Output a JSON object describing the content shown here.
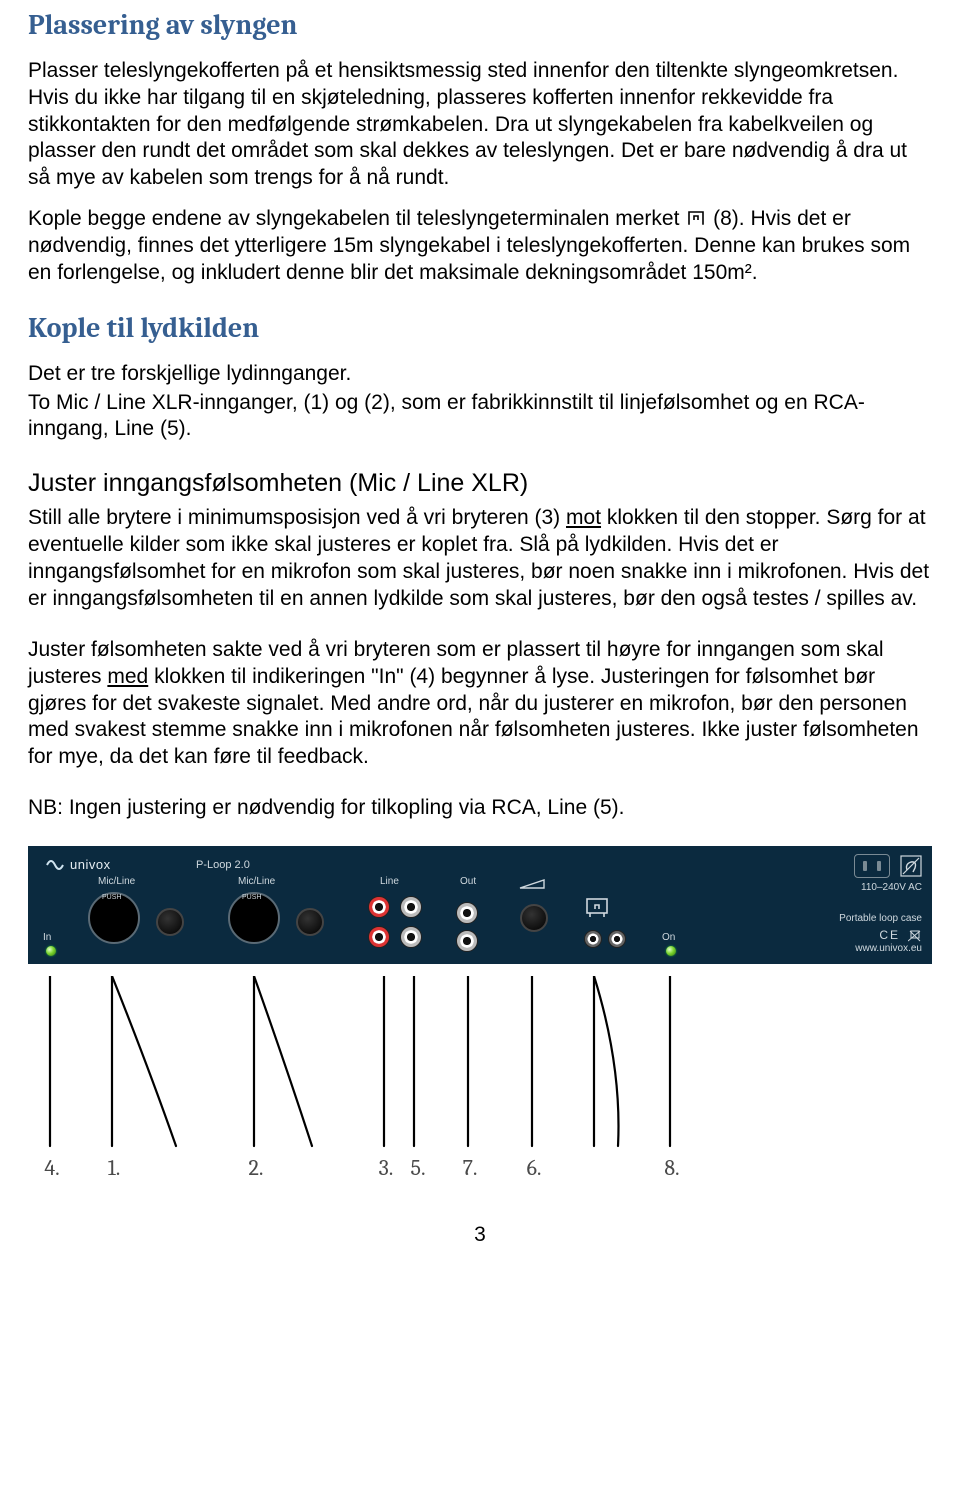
{
  "section1": {
    "heading": "Plassering av slyngen",
    "p1": "Plasser teleslyngekofferten på et hensiktsmessig sted innenfor den tiltenkte slyngeomkretsen. Hvis du ikke har tilgang til en skjøteledning, plasseres kofferten innenfor rekkevidde fra stikkontakten for den medfølgende strømkabelen. Dra ut slyngekabelen fra kabelkveilen og plasser den rundt det området som skal dekkes av teleslyngen. Det er bare nødvendig å dra ut så mye av kabelen som trengs for å nå rundt.",
    "p2a": "Kople begge endene av slyngekabelen til teleslyngeterminalen merket ",
    "p2b": "(8). Hvis det er nødvendig, finnes det ytterligere 15m slyngekabel i teleslyngekofferten. Denne kan brukes som en forlengelse, og inkludert denne blir det maksimale dekningsområdet 150m²."
  },
  "section2": {
    "heading": "Kople til lydkilden",
    "p1": "Det er tre forskjellige lydinnganger.",
    "p2": "To Mic / Line XLR-innganger, (1) og (2), som er fabrikkinnstilt til linjefølsomhet og en RCA-inngang, Line (5).",
    "sub": "Juster inngangsfølsomheten (Mic / Line XLR)",
    "p3a": "Still alle brytere i minimumsposisjon ved å vri bryteren (3) ",
    "p3mot": "mot",
    "p3b": " klokken til den stopper. Sørg for at eventuelle kilder som ikke skal justeres er koplet fra. Slå på lydkilden. Hvis det er inngangsfølsomhet for en mikrofon som skal justeres, bør noen snakke inn i mikrofonen. Hvis det er inngangsfølsomheten til en annen lydkilde som skal justeres, bør den også testes / spilles av.",
    "p4a": "Juster følsomheten sakte ved å vri bryteren som er plassert til høyre for inngangen som skal justeres ",
    "p4med": "med",
    "p4b": " klokken til indikeringen \"In\" (4) begynner å lyse. Justeringen for følsomhet bør gjøres for det svakeste signalet. Med andre ord, når du justerer en mikrofon, bør den personen med svakest stemme snakke inn i mikrofonen når følsomheten justeres. Ikke juster følsomheten for mye, da det kan føre til feedback.",
    "p5": "NB: Ingen justering er nødvendig for tilkopling via RCA, Line (5)."
  },
  "diagram": {
    "brand": "univox",
    "model": "P-Loop 2.0",
    "labels": {
      "micline1": "Mic/Line",
      "micline2": "Mic/Line",
      "push": "PUSH",
      "line": "Line",
      "out": "Out",
      "in": "In",
      "on": "On",
      "ac": "110–240V AC",
      "case": "Portable loop case",
      "url": "www.univox.eu"
    },
    "numbers": [
      "4.",
      "1.",
      "2.",
      "3.",
      "5.",
      "7.",
      "6.",
      "8."
    ]
  },
  "pageNumber": "3"
}
